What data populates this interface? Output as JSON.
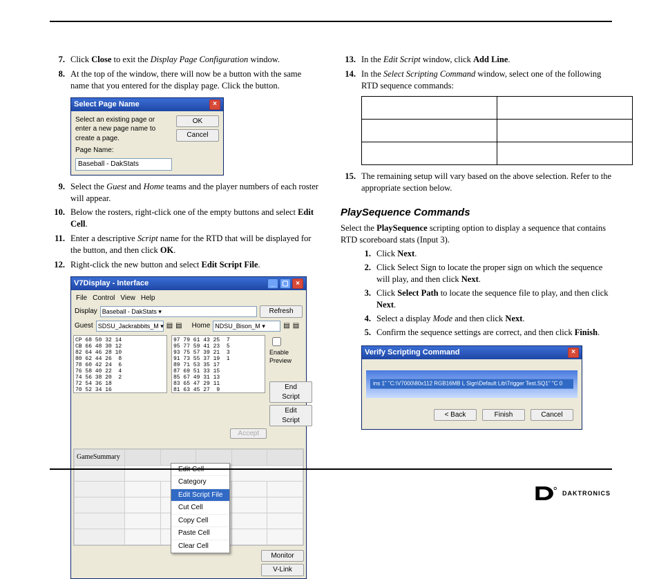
{
  "left": {
    "step7": {
      "bold": "Close",
      "italic": "Display Page Configuration"
    },
    "step8": "At the top of the window, there will now be a button with the same name that you entered for the display page. Click the button.",
    "step9": {
      "i1": "Guest",
      "i2": "Home"
    },
    "step10": {
      "bold": "Edit Cell"
    },
    "step11": {
      "italic": "Script",
      "bold": "OK"
    },
    "step12": {
      "bold": "Edit Script File"
    }
  },
  "win1": {
    "title": "Select Page Name",
    "instr": "Select an existing page or enter a new page name to create a page.",
    "pnLabel": "Page Name:",
    "value": "Baseball - DakStats",
    "ok": "OK",
    "cancel": "Cancel"
  },
  "win2": {
    "title": "V7Display - Interface",
    "menu": [
      "File",
      "Control",
      "View",
      "Help"
    ],
    "displayLabel": "Display",
    "displayValue": "Baseball - DakStats",
    "refresh": "Refresh",
    "guestLabel": "Guest",
    "guestValue": "SDSU_Jackrabbits_M",
    "homeLabel": "Home",
    "homeValue": "NDSU_Bison_M",
    "enablePreview": "Enable Preview",
    "endScript": "End Script",
    "editScript": "Edit Script",
    "accept": "Accept",
    "gridHeader": "GameSummary",
    "monitor": "Monitor",
    "vlink": "V-Link",
    "guestRoster": "CP 68 50 32 14\nCB 66 48 30 12\n82 64 46 28 10\n80 62 44 26  8\n78 60 42 24  6\n76 58 40 22  4\n74 56 38 20  2\n72 54 36 18\n70 52 34 16",
    "homeRoster": "97 79 61 43 25  7\n95 77 59 41 23  5\n93 75 57 39 21  3\n91 73 55 37 19  1\n89 71 53 35 17\n87 69 51 33 15\n85 67 49 31 13\n83 65 47 29 11\n81 63 45 27  9",
    "ctx": [
      "Edit Cell",
      "Category",
      "Edit Script File",
      "Cut Cell",
      "Copy Cell",
      "Paste Cell",
      "Clear Cell"
    ]
  },
  "right": {
    "step13": {
      "italic": "Edit Script",
      "bold": "Add Line"
    },
    "step14": {
      "italic": "Select Scripting Command"
    },
    "step15": "The remaining setup will vary based on the above selection. Refer to the appropriate section below.",
    "psHeading": "PlaySequence Commands",
    "psBold": "PlaySequence",
    "ps": [
      "Next",
      "Next",
      "Select Path",
      "Next",
      "Mode",
      "Next",
      "Finish"
    ]
  },
  "win3": {
    "title": "Verify Scripting Command",
    "path": "ins 1\" \"C:\\V7000\\80x112 RGB16MB L Sign\\Default Lib\\Trigger Test.SQ1\" \"C 0",
    "back": "< Back",
    "finish": "Finish",
    "cancel": "Cancel"
  },
  "footer": {
    "brand": "DAKTRONICS"
  }
}
